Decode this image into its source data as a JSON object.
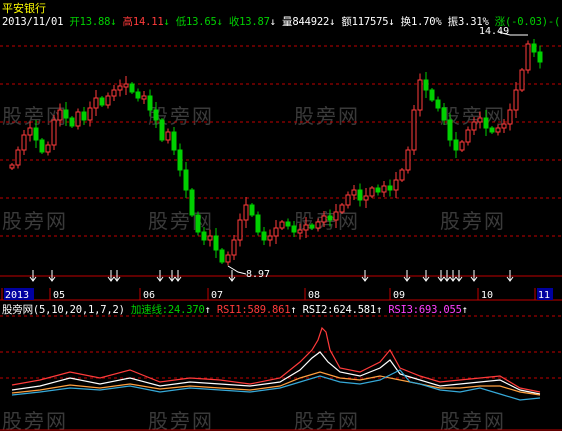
{
  "window": {
    "title": "平安银行"
  },
  "quote_bar": {
    "date": "2013/11/01",
    "open_label": "开",
    "open_value": "13.88",
    "open_arrow": "↓",
    "high_label": "高",
    "high_value": "14.11",
    "high_arrow": "↓",
    "low_label": "低",
    "low_value": "13.65",
    "low_arrow": "↓",
    "close_label": "收",
    "close_value": "13.87",
    "close_arrow": "↓",
    "volume_label": "量",
    "volume_value": "844922",
    "volume_arrow": "↓",
    "amount_label": "额",
    "amount_value": "117575",
    "amount_arrow": "↓",
    "turnover_label": "换",
    "turnover_value": "1.70%",
    "amplitude_label": "振",
    "amplitude_value": "3.31%",
    "change_label": "涨",
    "change_value": "(-0.03)-("
  },
  "price_chart": {
    "high_marker": "14.49",
    "low_marker": "8.97",
    "grid_color": "#c00000",
    "up_color": "#ff3b3b",
    "down_color": "#00d000"
  },
  "time_axis": {
    "labels": [
      {
        "text": "2013",
        "highlight": true
      },
      {
        "text": "05"
      },
      {
        "text": "06"
      },
      {
        "text": "07"
      },
      {
        "text": "08"
      },
      {
        "text": "09"
      },
      {
        "text": "10"
      },
      {
        "text": "11",
        "highlight": true
      }
    ]
  },
  "indicator_bar": {
    "name": "股旁网",
    "params": "(5,10,20,1,7,2)",
    "accel_label": "加速线:",
    "accel_value": "24.370",
    "accel_arrow": "↑",
    "rsi1_label": "RSI1:",
    "rsi1_value": "589.861",
    "rsi1_arrow": "↑",
    "rsi2_label": "RSI2:",
    "rsi2_value": "624.581",
    "rsi2_arrow": "↑",
    "rsi3_label": "RSI3:",
    "rsi3_value": "693.055",
    "rsi3_arrow": "↑"
  },
  "watermark": {
    "text": "股旁网"
  },
  "colors": {
    "accel": "#00d000",
    "rsi1": "#ff3b3b",
    "rsi2": "#ffffff",
    "rsi3": "#ff40ff",
    "blue": "#36a9d8",
    "orange": "#ffa040"
  }
}
